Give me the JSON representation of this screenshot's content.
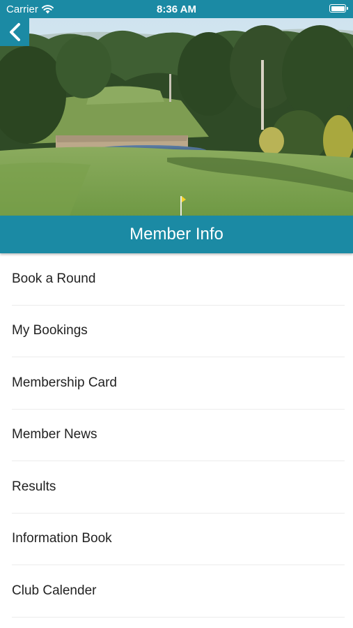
{
  "status_bar": {
    "carrier": "Carrier",
    "time": "8:36 AM",
    "wifi_icon": "wifi-icon",
    "battery_icon": "battery-icon"
  },
  "nav": {
    "back_icon": "chevron-left-icon"
  },
  "hero": {
    "image": "golf-course-photo"
  },
  "header": {
    "title": "Member Info"
  },
  "menu": {
    "items": [
      {
        "label": "Book a Round"
      },
      {
        "label": "My Bookings"
      },
      {
        "label": "Membership Card"
      },
      {
        "label": "Member News"
      },
      {
        "label": "Results"
      },
      {
        "label": "Information Book"
      },
      {
        "label": "Club Calender"
      }
    ]
  },
  "colors": {
    "accent": "#1b8aa4",
    "text": "#222222",
    "divider": "#ececec"
  }
}
